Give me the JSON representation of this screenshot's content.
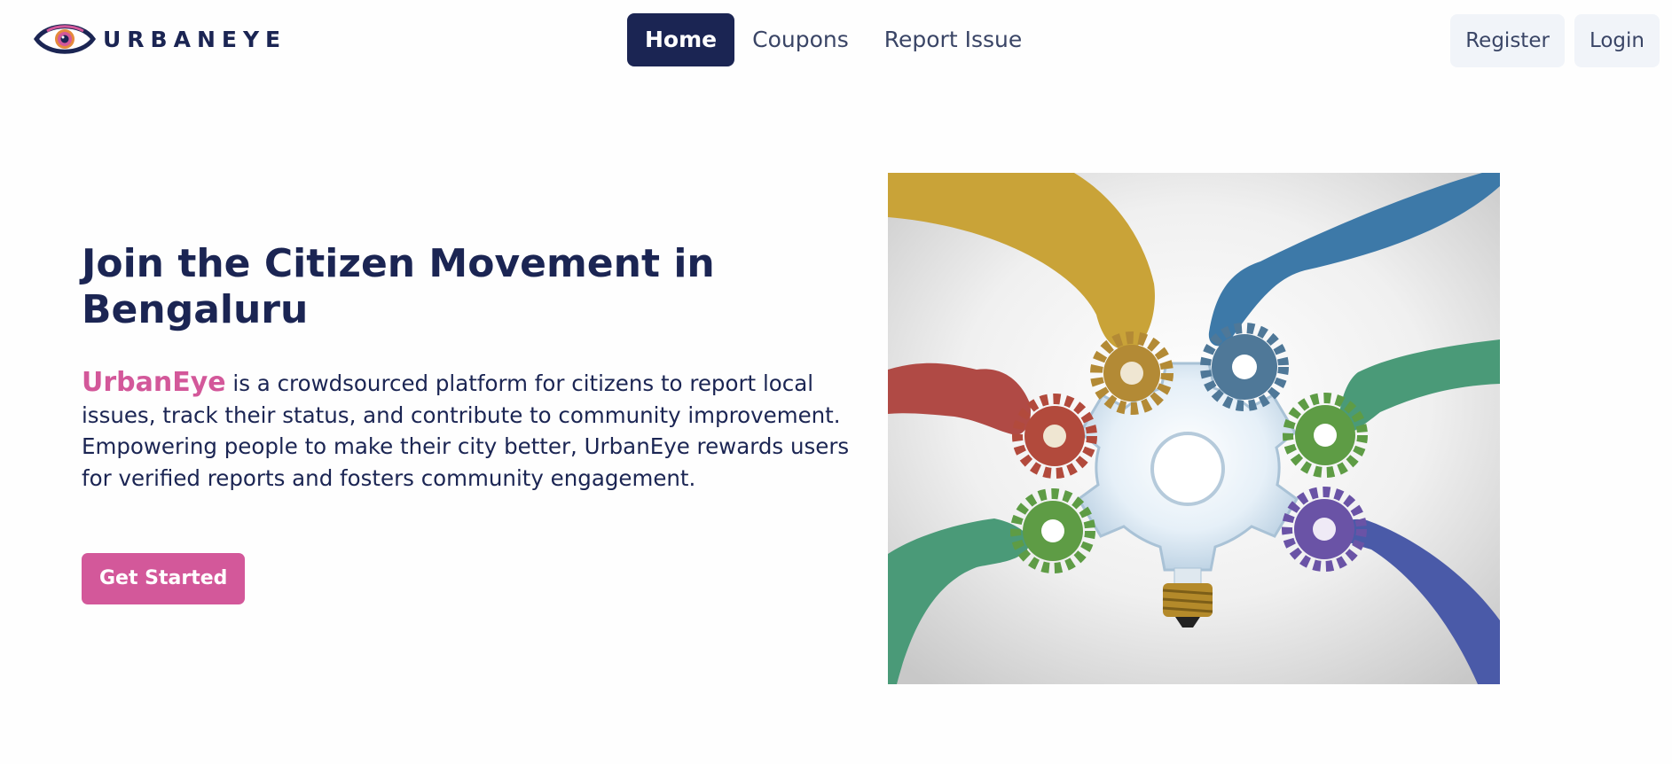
{
  "header": {
    "logo_text": "URBANEYE",
    "nav": [
      {
        "label": "Home",
        "active": true
      },
      {
        "label": "Coupons",
        "active": false
      },
      {
        "label": "Report Issue",
        "active": false
      }
    ],
    "auth": {
      "register_label": "Register",
      "login_label": "Login"
    }
  },
  "hero": {
    "title": "Join the Citizen Movement in Bengaluru",
    "brand_name": "UrbanEye",
    "description": " is a crowdsourced platform for citizens to report local issues, track their status, and contribute to community improvement. Empowering people to make their city better, UrbanEye rewards users for verified reports and fosters community engagement.",
    "cta_label": "Get Started"
  },
  "colors": {
    "primary_navy": "#1b2553",
    "accent_pink": "#d3589a",
    "auth_button_bg": "#f1f4f9"
  },
  "image": {
    "icon": "hands-with-gears-lightbulb-illustration"
  }
}
